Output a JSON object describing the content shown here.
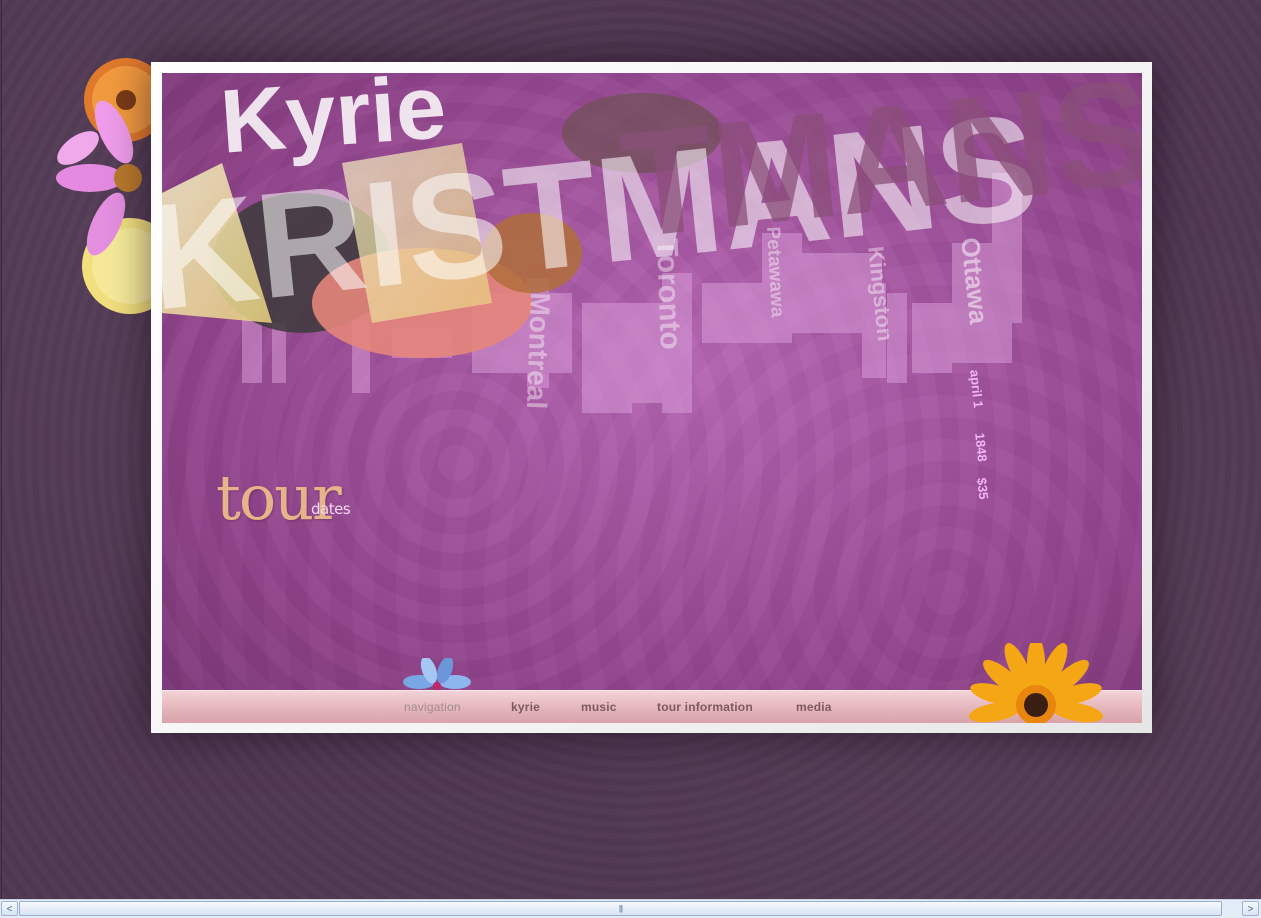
{
  "site": {
    "artist_name": "KRISTMANS",
    "header_fragment": "Kyrie"
  },
  "tour": {
    "title": "tour",
    "subtitle": "dates",
    "cities": [
      "Montreal",
      "Toronto",
      "Petawawa",
      "Kingston",
      "Ottawa"
    ],
    "featured": {
      "city": "Ottawa",
      "date": "april 1",
      "time": "1848",
      "price": "$35"
    }
  },
  "navigation": {
    "heading": "navigation",
    "items": [
      {
        "label": "kyrie"
      },
      {
        "label": "music"
      },
      {
        "label": "tour information"
      },
      {
        "label": "media"
      }
    ]
  },
  "scrollbar": {
    "left_arrow": "<",
    "right_arrow": ">",
    "grip": "|||"
  },
  "colors": {
    "page_background": "#503852",
    "stage_purple": "#a3549f",
    "nav_bar": "#e8bcc1",
    "title_peach": "#e6b48b",
    "detail_pink": "#f0b6f0"
  }
}
